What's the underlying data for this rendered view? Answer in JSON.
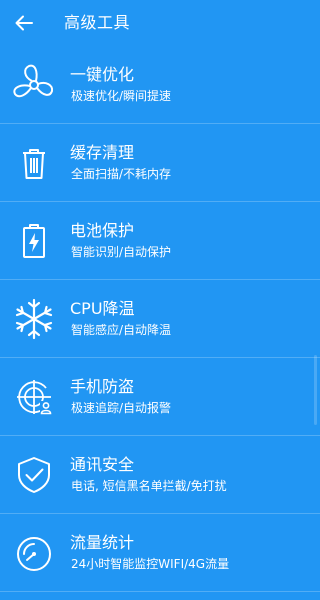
{
  "header": {
    "title": "高级工具",
    "back_icon": "arrow-left-icon"
  },
  "colors": {
    "background": "#2196f3",
    "foreground": "#ffffff"
  },
  "tools": [
    {
      "icon": "fan-icon",
      "title": "一键优化",
      "subtitle": "极速优化/瞬间提速"
    },
    {
      "icon": "trash-icon",
      "title": "缓存清理",
      "subtitle": "全面扫描/不耗内存"
    },
    {
      "icon": "battery-icon",
      "title": "电池保护",
      "subtitle": "智能识别/自动保护"
    },
    {
      "icon": "snowflake-icon",
      "title": "CPU降温",
      "subtitle": "智能感应/自动降温"
    },
    {
      "icon": "radar-icon",
      "title": "手机防盗",
      "subtitle": "极速追踪/自动报警"
    },
    {
      "icon": "shield-check-icon",
      "title": "通讯安全",
      "subtitle": "电话, 短信黑名单拦截/免打扰"
    },
    {
      "icon": "speedometer-icon",
      "title": "流量统计",
      "subtitle": "24小时智能监控WIFI/4G流量"
    }
  ]
}
